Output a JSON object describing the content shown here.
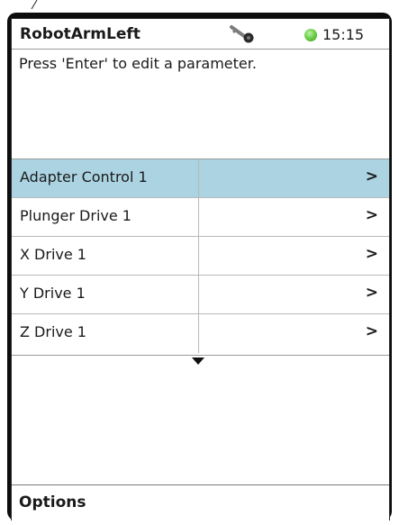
{
  "header": {
    "title": "RobotArmLeft",
    "time": "15:15",
    "status_icon": "green-status-dot",
    "lock_icon": "key-icon"
  },
  "message": "Press 'Enter' to edit a parameter.",
  "parameters": [
    {
      "label": "Adapter Control 1",
      "arrow": ">",
      "selected": true
    },
    {
      "label": "Plunger Drive 1",
      "arrow": ">",
      "selected": false
    },
    {
      "label": "X Drive 1",
      "arrow": ">",
      "selected": false
    },
    {
      "label": "Y Drive 1",
      "arrow": ">",
      "selected": false
    },
    {
      "label": "Z Drive 1",
      "arrow": ">",
      "selected": false
    }
  ],
  "footer": {
    "options_label": "Options"
  },
  "colors": {
    "selected_row": "#abd3e1",
    "status_green": "#5cc83a"
  }
}
